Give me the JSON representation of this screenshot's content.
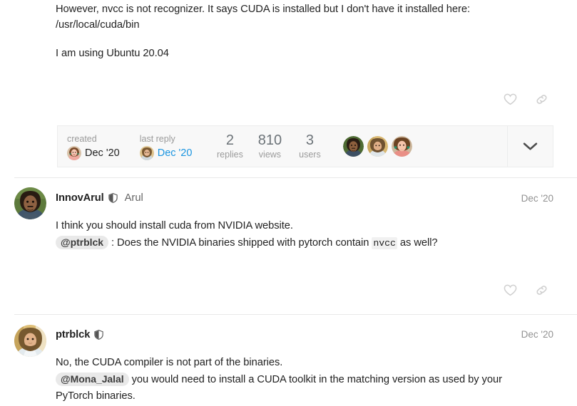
{
  "original_post": {
    "paragraphs": [
      "However, nvcc is not recognizer. It says CUDA is installed but I don't have it installed here: /usr/local/cuda/bin",
      "I am using Ubuntu 20.04"
    ],
    "actions": {
      "like_label": "like-this-post",
      "link_label": "copy-link-to-post"
    }
  },
  "topic_meta": {
    "created_label": "created",
    "created_date": "Dec '20",
    "last_reply_label": "last reply",
    "last_reply_date": "Dec '20",
    "stats": [
      {
        "value": "2",
        "label": "replies"
      },
      {
        "value": "810",
        "label": "views"
      },
      {
        "value": "3",
        "label": "users"
      }
    ],
    "participants": [
      {
        "name": "InnovArul"
      },
      {
        "name": "ptrblck"
      },
      {
        "name": "Mona_Jalal"
      }
    ],
    "expand_label": "expand-topic-details",
    "background_color": "#f8f8f8",
    "border_color": "#eceded",
    "link_color": "#1b95e0"
  },
  "posts": [
    {
      "username": "InnovArul",
      "has_badge": true,
      "fullname": "Arul",
      "date": "Dec '20",
      "lines": [
        {
          "type": "text",
          "text": "I think you should install cuda from NVIDIA website."
        },
        {
          "type": "rich",
          "mention": "@ptrblck",
          "before": "",
          "mid": " : Does the NVIDIA binaries shipped with pytorch contain ",
          "code": "nvcc",
          "after": " as well?"
        }
      ],
      "actions": {
        "like_label": "like-this-post",
        "link_label": "copy-link-to-post"
      }
    },
    {
      "username": "ptrblck",
      "has_badge": true,
      "fullname": "",
      "date": "Dec '20",
      "lines": [
        {
          "type": "text",
          "text": "No, the CUDA compiler is not part of the binaries."
        },
        {
          "type": "rich",
          "mention": "@Mona_Jalal",
          "before": "",
          "mid": " you would need to install a CUDA toolkit in the matching version as used by your PyTorch binaries.",
          "code": "",
          "after": ""
        }
      ],
      "actions": {
        "like_label": "like-this-post",
        "link_label": "copy-link-to-post"
      }
    }
  ]
}
